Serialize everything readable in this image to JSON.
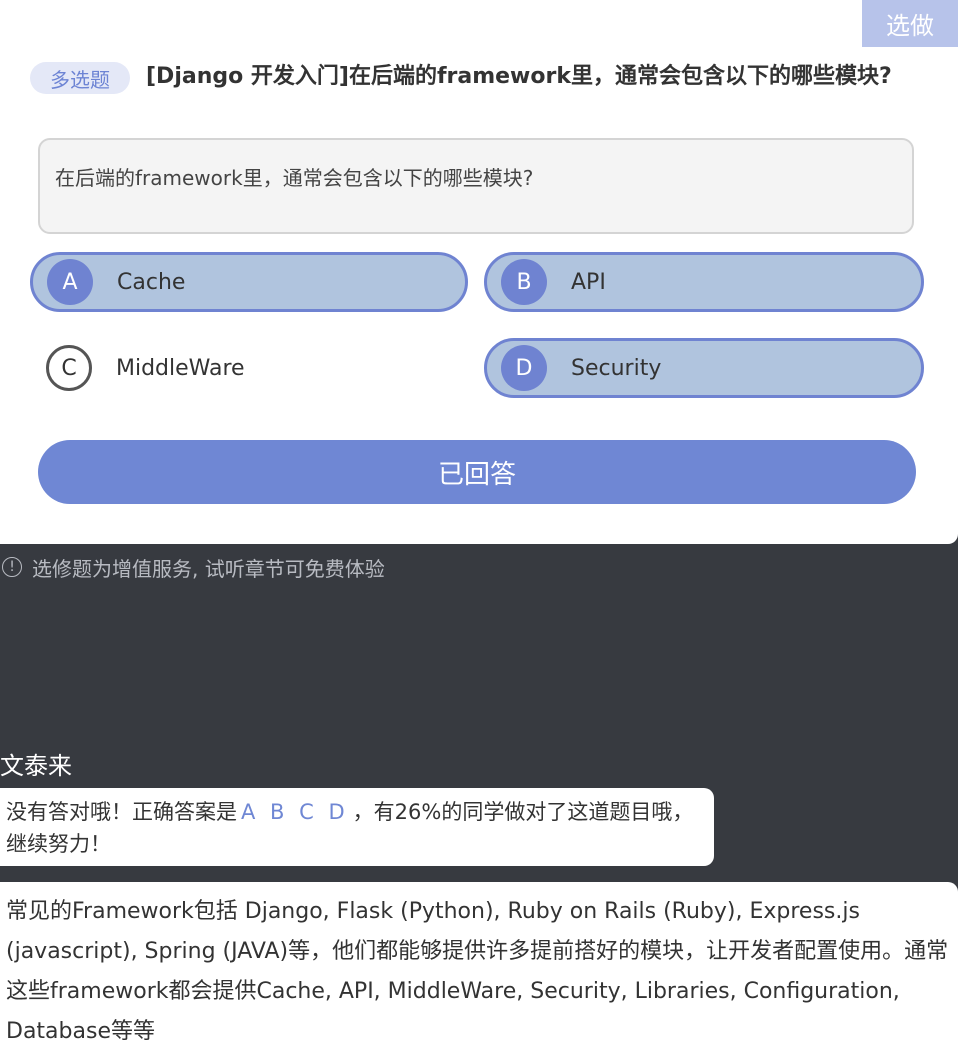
{
  "header": {
    "pick_label": "选做"
  },
  "question": {
    "type_tag": "多选题",
    "title": "[Django 开发入门]在后端的framework里，通常会包含以下的哪些模块?",
    "body": "在后端的framework里，通常会包含以下的哪些模块?"
  },
  "options": [
    {
      "letter": "A",
      "label": "Cache",
      "selected": true
    },
    {
      "letter": "B",
      "label": "API",
      "selected": true
    },
    {
      "letter": "C",
      "label": "MiddleWare",
      "selected": false
    },
    {
      "letter": "D",
      "label": "Security",
      "selected": true
    }
  ],
  "submit": {
    "label": "已回答"
  },
  "notice": {
    "text": "选修题为增值服务, 试听章节可免费体验"
  },
  "feedback": {
    "author": "文泰来",
    "result_prefix": "没有答对哦！正确答案是",
    "correct_answer": "A B C D",
    "result_suffix": "，有26%的同学做对了这道题目哦，继续努力！",
    "explanation": "常见的Framework包括 Django, Flask (Python), Ruby on Rails (Ruby), Express.js (javascript), Spring (JAVA)等，他们都能够提供许多提前搭好的模块，让开发者配置使用。通常这些framework都会提供Cache, API, MiddleWare, Security, Libraries, Configuration, Database等等"
  },
  "colors": {
    "accent": "#6f87d4",
    "selected_bg": "#b0c4de",
    "dark_bg": "#373a40",
    "tag_bg": "#e4e8f7"
  }
}
